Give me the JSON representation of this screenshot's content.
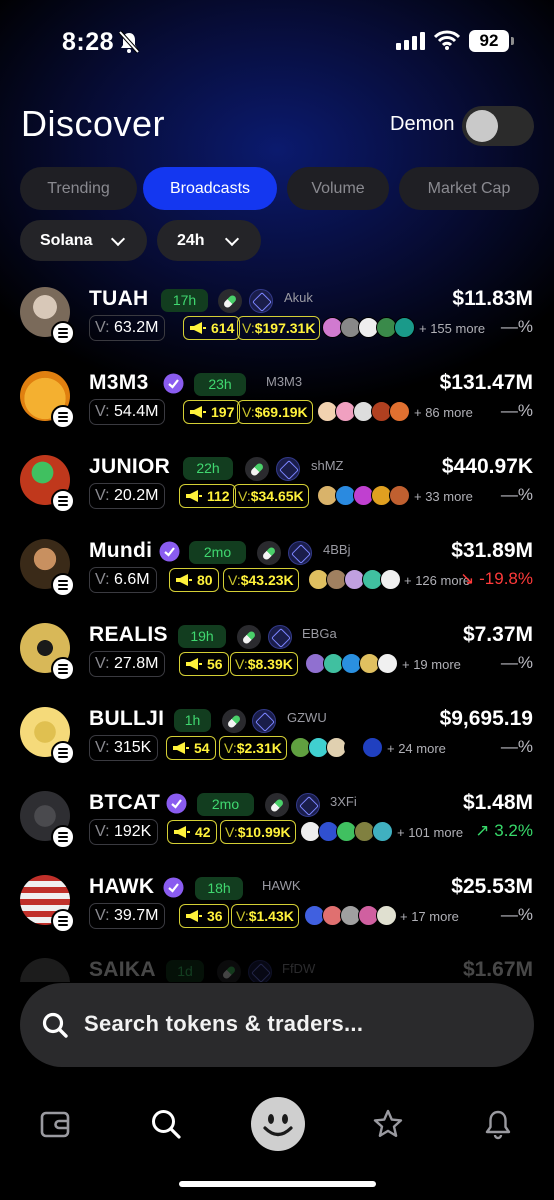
{
  "status_bar": {
    "time": "8:28",
    "battery": "92"
  },
  "header": {
    "title": "Discover",
    "toggle_label": "Demon",
    "toggle_on": false
  },
  "tabs": [
    {
      "label": "Trending",
      "active": false
    },
    {
      "label": "Broadcasts",
      "active": true
    },
    {
      "label": "Volume",
      "active": false
    },
    {
      "label": "Market Cap",
      "active": false
    }
  ],
  "filters": {
    "chain": "Solana",
    "timeframe": "24h"
  },
  "tokens": [
    {
      "name": "TUAH",
      "verified": false,
      "age": "17h",
      "dev": "Akuk",
      "price": "$11.83M",
      "volume": "63.2M",
      "broadcasts": "614",
      "volume_usd": "$197.31K",
      "more": "+ 155 more",
      "change": "—%",
      "trend": "neutral",
      "avatar_color": "#7a6a5a"
    },
    {
      "name": "M3M3",
      "verified": true,
      "age": "23h",
      "dev": "M3M3",
      "price": "$131.47M",
      "volume": "54.4M",
      "broadcasts": "197",
      "volume_usd": "$69.19K",
      "more": "+ 86 more",
      "change": "—%",
      "trend": "neutral",
      "avatar_color": "#f0a020"
    },
    {
      "name": "JUNIOR",
      "verified": false,
      "age": "22h",
      "dev": "shMZ",
      "price": "$440.97K",
      "volume": "20.2M",
      "broadcasts": "112",
      "volume_usd": "$34.65K",
      "more": "+ 33 more",
      "change": "—%",
      "trend": "neutral",
      "avatar_color": "#c0381c"
    },
    {
      "name": "Mundi",
      "verified": true,
      "age": "2mo",
      "dev": "4BBj",
      "price": "$31.89M",
      "volume": "6.6M",
      "broadcasts": "80",
      "volume_usd": "$43.23K",
      "more": "+ 126 more",
      "change": "-19.8%",
      "trend": "down",
      "avatar_color": "#4a3a28"
    },
    {
      "name": "REALIS",
      "verified": false,
      "age": "19h",
      "dev": "EBGa",
      "price": "$7.37M",
      "volume": "27.8M",
      "broadcasts": "56",
      "volume_usd": "$8.39K",
      "more": "+ 19 more",
      "change": "—%",
      "trend": "neutral",
      "avatar_color": "#c8a64a"
    },
    {
      "name": "BULLJI",
      "verified": false,
      "age": "1h",
      "dev": "GZWU",
      "price": "$9,695.19",
      "volume": "315K",
      "broadcasts": "54",
      "volume_usd": "$2.31K",
      "more": "+ 24 more",
      "change": "—%",
      "trend": "neutral",
      "avatar_color": "#f3d36a"
    },
    {
      "name": "BTCAT",
      "verified": true,
      "age": "2mo",
      "dev": "3XFi",
      "price": "$1.48M",
      "volume": "192K",
      "broadcasts": "42",
      "volume_usd": "$10.99K",
      "more": "+ 101 more",
      "change": "3.2%",
      "trend": "up",
      "avatar_color": "#3a3a3e"
    },
    {
      "name": "HAWK",
      "verified": true,
      "age": "18h",
      "dev": "HAWK",
      "price": "$25.53M",
      "volume": "39.7M",
      "broadcasts": "36",
      "volume_usd": "$1.43K",
      "more": "+ 17 more",
      "change": "—%",
      "trend": "neutral",
      "avatar_color": "#b8322a"
    },
    {
      "name": "SAIKA",
      "verified": false,
      "age": "1d",
      "dev": "FfDW",
      "price": "$1.67M",
      "volume": "",
      "broadcasts": "",
      "volume_usd": "",
      "more": "",
      "change": "",
      "trend": "neutral",
      "avatar_color": "#555"
    }
  ],
  "labels": {
    "volume_prefix": "V:"
  },
  "search": {
    "placeholder": "Search tokens & traders..."
  },
  "colors": {
    "accent": "#1437f0",
    "highlight": "#fff23b",
    "positive": "#37d96a",
    "negative": "#ff3a3a"
  },
  "tab_bar": [
    "wallet-icon",
    "search-icon",
    "smiley-icon",
    "star-icon",
    "bell-icon"
  ]
}
